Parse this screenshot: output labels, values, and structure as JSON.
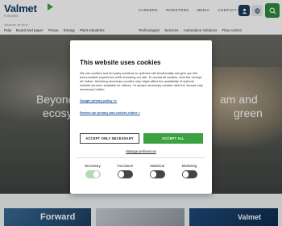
{
  "header": {
    "logo_text": "Valmet",
    "logo_tagline": "FORWARD",
    "top_links": [
      "CAREERS",
      "INVESTORS",
      "MEDIA",
      "CONTACT US"
    ],
    "breadcrumb": "Industries we serve",
    "nav_left": [
      "Pulp",
      "Board and paper",
      "Tissue",
      "Energy",
      "Plant industries"
    ],
    "nav_right": [
      "Technologies",
      "Services",
      "Automation solutions",
      "Flow control"
    ],
    "colors": {
      "brand": "#0d3a63",
      "search": "#2d8a3f"
    }
  },
  "hero": {
    "line1": "Beyond",
    "line1_end": "am and",
    "line2": "ecosy",
    "line2_end": "green"
  },
  "cards": {
    "card1_text": "Forward",
    "card3_text": "Valmet"
  },
  "cookie": {
    "title": "This website uses cookies",
    "body": "We use cookies and 3rd party solutions to optimize site functionality and give you the best possible experience while browsing our site. To accept all cookies, click the 'Accept all' button. Selecting necessary cookies only might affect the availability of optional website services available for visitors. To accept necessary cookies click the 'Accept only necessary' button.",
    "privacy_link": "Google privacy policy >>",
    "review_link": "Review our privacy and cookies notice >",
    "accept_necessary": "ACCEPT ONLY NECESSARY",
    "accept_all": "ACCEPT ALL",
    "manage": "Manage preferences",
    "toggles": [
      {
        "label": "Necessary",
        "state": "on-disabled"
      },
      {
        "label": "Functional",
        "state": "off"
      },
      {
        "label": "Statistical",
        "state": "off"
      },
      {
        "label": "Marketing",
        "state": "off"
      }
    ],
    "accent_color": "#3ca241"
  }
}
